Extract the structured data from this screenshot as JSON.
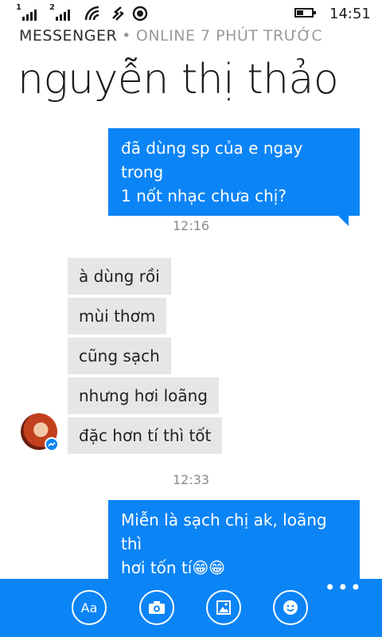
{
  "status_bar": {
    "sim1": "1",
    "sim2": "2",
    "time": "14:51",
    "icons": [
      "signal-icon",
      "signal-icon",
      "wifi-icon",
      "data-icon",
      "location-icon",
      "battery-icon"
    ]
  },
  "header": {
    "app_name": "MESSENGER",
    "separator": "•",
    "presence": "ONLINE 7 PHÚT TRƯỚC",
    "contact_name": "nguyễn thị thảo"
  },
  "messages": [
    {
      "type": "out",
      "lines": [
        "đã dùng sp của e ngay trong",
        "1 nốt nhạc chưa chị?"
      ]
    },
    {
      "type": "timestamp",
      "text": "12:16"
    },
    {
      "type": "in",
      "text": "à dùng rồi"
    },
    {
      "type": "in",
      "text": "mùi thơm"
    },
    {
      "type": "in",
      "text": "cũng sạch"
    },
    {
      "type": "in",
      "text": "nhưng hơi loãng"
    },
    {
      "type": "in",
      "text": "đặc hơn tí thì tốt"
    },
    {
      "type": "timestamp",
      "text": "12:33"
    },
    {
      "type": "out",
      "lines": [
        "Miễn là sạch chị ak, loãng thì",
        "hơi tốn tí😁😁"
      ]
    }
  ],
  "app_bar": {
    "buttons": [
      {
        "name": "text-format-button",
        "label": "Aa"
      },
      {
        "name": "camera-button",
        "icon": "camera-icon"
      },
      {
        "name": "photo-button",
        "icon": "photo-icon"
      },
      {
        "name": "emoji-button",
        "icon": "smiley-icon"
      }
    ],
    "more_label": "•••"
  },
  "colors": {
    "accent": "#0b84f6",
    "incoming_bubble": "#e6e6e6"
  }
}
